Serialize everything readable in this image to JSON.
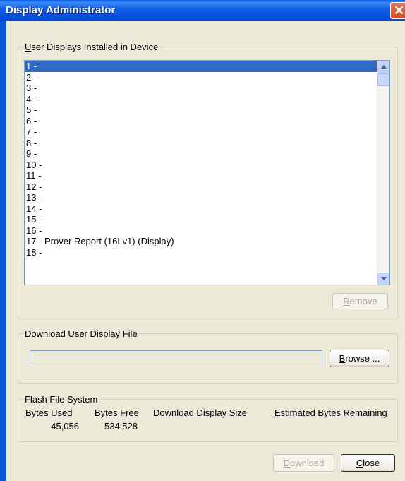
{
  "window": {
    "title": "Display Administrator",
    "close_glyph": "✕"
  },
  "installed": {
    "group_label_key": "U",
    "group_label_rest": "ser Displays Installed in Device",
    "items": [
      "1 -",
      "2 -",
      "3 -",
      "4 -",
      "5 -",
      "6 -",
      "7 -",
      "8 -",
      "9 -",
      "10 -",
      "11 -",
      "12 -",
      "13 -",
      "14 -",
      "15 -",
      "16 -",
      "17 - Prover Report (16Lv1)  (Display)",
      "18 -"
    ],
    "selected_index": 0,
    "remove_key": "R",
    "remove_rest": "emove"
  },
  "download_file": {
    "group_label": "Download User Display File",
    "path_value": "",
    "browse_key": "B",
    "browse_rest": "rowse ..."
  },
  "flash": {
    "group_label": "Flash File System",
    "bytes_used_label": "Bytes Used",
    "bytes_free_label": "Bytes Free",
    "download_size_label": "Download Display Size",
    "remaining_label": "Estimated Bytes Remaining",
    "bytes_used": "45,056",
    "bytes_free": "534,528",
    "download_size": "",
    "remaining": ""
  },
  "footer": {
    "download_key": "D",
    "download_rest": "ownload",
    "close_key": "C",
    "close_rest": "lose"
  }
}
